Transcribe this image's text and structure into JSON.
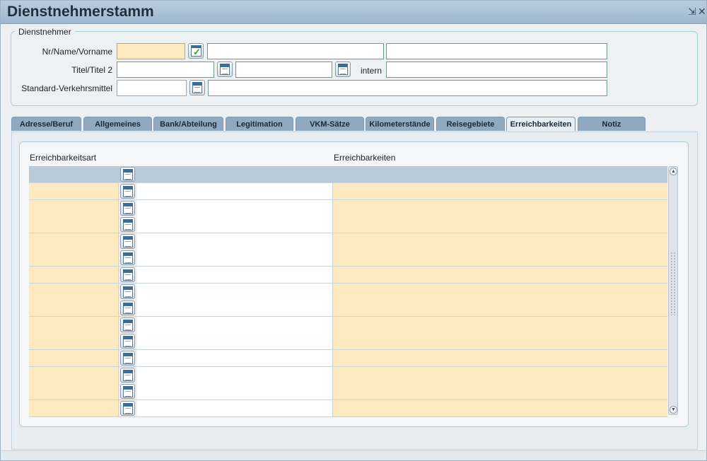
{
  "window": {
    "title": "Dienstnehmerstamm",
    "restore_glyph": "⇲",
    "close_glyph": "✕"
  },
  "colors": {
    "required_field": "#fde9be",
    "tab_inactive": "#8fa9c0",
    "tab_active": "#e6eef4",
    "grid_header": "#b9cad8"
  },
  "icons": {
    "lookup": "calendar-list-icon",
    "confirm": "check-icon",
    "scroll_up": "▲",
    "scroll_down": "▼"
  },
  "dienstnehmer": {
    "legend": "Dienstnehmer",
    "nr_label": "Nr/Name/Vorname",
    "titel_label": "Titel/Titel 2",
    "intern_label": "intern",
    "verkehr_label": "Standard-Verkehrsmittel",
    "nr_value": "",
    "name_value": "",
    "vorname_value": "",
    "titel_value": "",
    "titel2_value": "",
    "intern_value": "",
    "verkehr_code": "",
    "verkehr_text": ""
  },
  "tabs": [
    {
      "label": "Adresse/Beruf",
      "active": false
    },
    {
      "label": "Allgemeines",
      "active": false
    },
    {
      "label": "Bank/Abteilung",
      "active": false
    },
    {
      "label": "Legitimation",
      "active": false
    },
    {
      "label": "VKM-Sätze",
      "active": false
    },
    {
      "label": "Kilometerstände",
      "active": false
    },
    {
      "label": "Reisegebiete",
      "active": false
    },
    {
      "label": "Erreichbarkeiten",
      "active": true
    },
    {
      "label": "Notiz",
      "active": false
    }
  ],
  "grid": {
    "col_art": "Erreichbarkeitsart",
    "col_value": "Erreichbarkeiten",
    "rows": [
      "",
      "",
      "",
      "",
      "",
      "",
      "",
      "",
      "",
      "",
      "",
      "",
      "",
      ""
    ]
  }
}
